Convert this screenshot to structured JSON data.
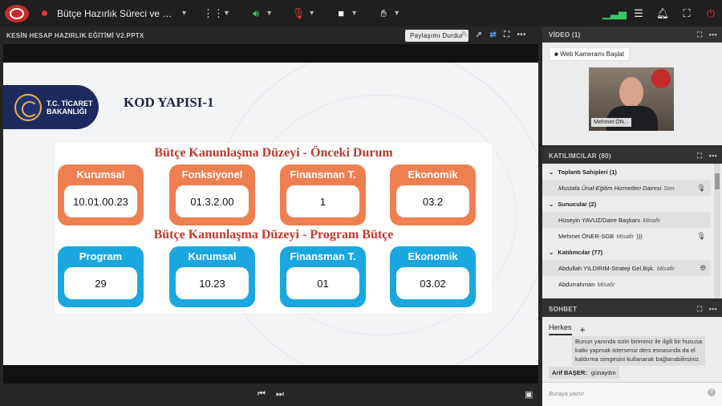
{
  "meeting": {
    "title": "Bütçe Hazırlık Süreci ve Kesin Hesap"
  },
  "colors": {
    "accent": "#ee7f50",
    "blue": "#1aa7df",
    "title_red": "#c0392b",
    "record": "#e53935"
  },
  "presentation": {
    "filename": "KESİN HESAP HAZIRLIK EĞİTİMİ V2.PPTX",
    "stop_sharing_label": "Paylaşımı Durdur",
    "slide": {
      "org_name_line1": "T.C. TİCARET",
      "org_name_line2": "BAKANLIĞI",
      "title": "KOD YAPISI-1",
      "section1": {
        "title": "Bütçe Kanunlaşma Düzeyi - Önceki Durum",
        "cards": [
          {
            "label": "Kurumsal",
            "value": "10.01.00.23"
          },
          {
            "label": "Fonksiyonel",
            "value": "01.3.2.00"
          },
          {
            "label": "Finansman T.",
            "value": "1"
          },
          {
            "label": "Ekonomik",
            "value": "03.2"
          }
        ]
      },
      "section2": {
        "title": "Bütçe Kanunlaşma Düzeyi - Program Bütçe",
        "cards": [
          {
            "label": "Program",
            "value": "29"
          },
          {
            "label": "Kurumsal",
            "value": "10.23"
          },
          {
            "label": "Finansman T.",
            "value": "01"
          },
          {
            "label": "Ekonomik",
            "value": "03.02"
          }
        ]
      }
    }
  },
  "video": {
    "header": "VİDEO (1)",
    "start_camera_label": "Web Kameramı Başlat",
    "participant_name": "Mehmet ÖN..."
  },
  "participants": {
    "header": "KATILIMCILAR (80)",
    "groups": [
      {
        "label": "Toplantı Sahipleri (1)"
      },
      {
        "label": "Sunucular (2)"
      },
      {
        "label": "Katılımcılar (77)"
      }
    ],
    "hosts": [
      {
        "name": "Mustafa Ünal-Eğitim Hizmetleri Dairesi",
        "role": "Sen"
      }
    ],
    "presenters": [
      {
        "name": "Hüseyin YAVUZ/Daire Başkanı",
        "role": "Misafir"
      },
      {
        "name": "Mehmet ÖNER-SGB",
        "role": "Misafir"
      }
    ],
    "attendees": [
      {
        "name": "Abdullah YILDIRIM-Strateji Gel.Bşk.",
        "role": "Misafir"
      },
      {
        "name": "Abdurrahman",
        "role": "Misafir"
      }
    ]
  },
  "chat": {
    "header": "SOHBET",
    "tab_everyone": "Herkes",
    "message1": "Bunun yanında sizin biriminiz ile ilgili bir hususa katkı yapmak isterseniz ders esnasında da el kaldırma simgesini kullanarak bağlanabilirsiniz.",
    "message2_author": "Arif BAŞER:",
    "message2_text": "günaydın",
    "input_placeholder": "Buraya yazın"
  }
}
